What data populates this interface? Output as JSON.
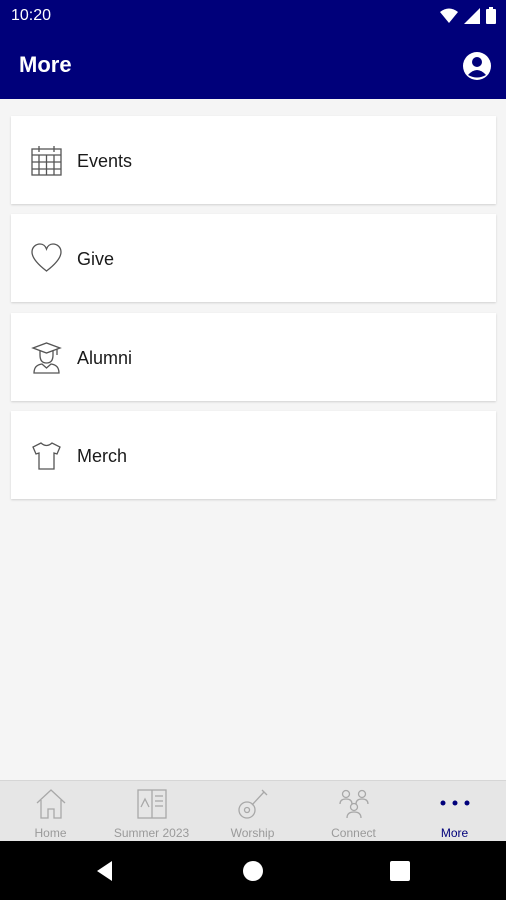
{
  "status": {
    "time": "10:20"
  },
  "appbar": {
    "title": "More"
  },
  "menu": {
    "items": [
      {
        "label": "Events",
        "icon": "calendar-icon"
      },
      {
        "label": "Give",
        "icon": "heart-icon"
      },
      {
        "label": "Alumni",
        "icon": "graduate-icon"
      },
      {
        "label": "Merch",
        "icon": "tshirt-icon"
      }
    ]
  },
  "tabs": [
    {
      "label": "Home",
      "icon": "home-icon"
    },
    {
      "label": "Summer 2023",
      "icon": "book-icon"
    },
    {
      "label": "Worship",
      "icon": "guitar-icon"
    },
    {
      "label": "Connect",
      "icon": "people-icon"
    },
    {
      "label": "More",
      "icon": "more-dots-icon",
      "active": true
    }
  ],
  "colors": {
    "accent": "#00007a",
    "inactive": "#9a9a9a"
  }
}
